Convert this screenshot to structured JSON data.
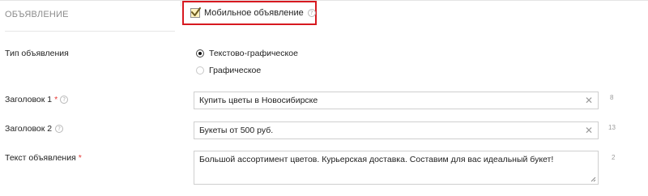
{
  "section": {
    "title": "ОБЪЯВЛЕНИЕ"
  },
  "mobile": {
    "label": "Мобильное объявление",
    "checked": true,
    "help_glyph": "?"
  },
  "ad_type": {
    "label": "Тип объявления",
    "options": [
      {
        "label": "Текстово-графическое",
        "selected": true
      },
      {
        "label": "Графическое",
        "selected": false
      }
    ]
  },
  "headline1": {
    "label": "Заголовок 1",
    "required_mark": "*",
    "help_glyph": "?",
    "value": "Купить цветы в Новосибирске",
    "counter": "8"
  },
  "headline2": {
    "label": "Заголовок 2",
    "help_glyph": "?",
    "value": "Букеты от 500 руб.",
    "counter": "13"
  },
  "ad_text": {
    "label": "Текст объявления",
    "required_mark": "*",
    "value": "Большой ассортимент цветов. Курьерская доставка. Составим для вас идеальный букет!",
    "counter": "2"
  },
  "colors": {
    "highlight": "#d71920",
    "checkbox_fill": "#fff3bf",
    "required": "#e53935"
  },
  "icons": {
    "clear": "close-icon",
    "help": "help-circle-icon",
    "check": "checkmark-icon",
    "resize": "resize-grip-icon"
  }
}
